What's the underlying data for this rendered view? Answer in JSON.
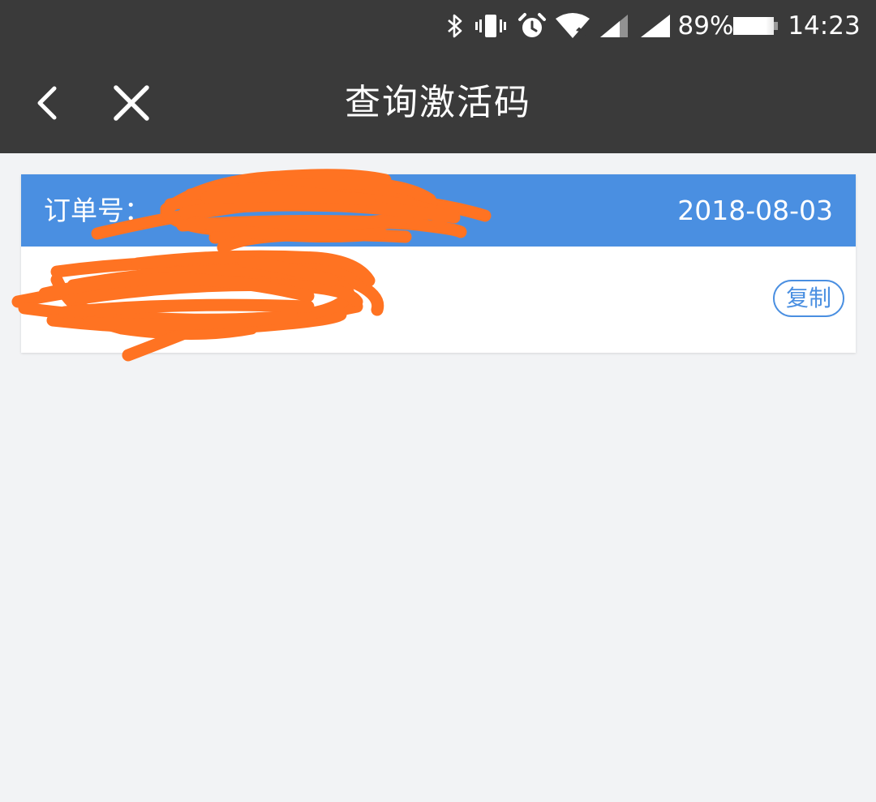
{
  "status_bar": {
    "battery": "89%",
    "time": "14:23",
    "icons": [
      "bluetooth-icon",
      "vibrate-icon",
      "alarm-icon",
      "wifi-icon",
      "signal-icon",
      "signal-icon",
      "battery-icon"
    ]
  },
  "toolbar": {
    "back_icon": "chevron-left-icon",
    "close_icon": "close-icon",
    "title": "查询激活码"
  },
  "order": {
    "label": "订单号：",
    "number": "",
    "date": "2018-08-03",
    "code": "",
    "copy_label": "复制"
  },
  "colors": {
    "bar": "#3a3a3a",
    "header_blue": "#4a8fe1",
    "background": "#f2f3f5",
    "redaction": "#ff7322"
  }
}
